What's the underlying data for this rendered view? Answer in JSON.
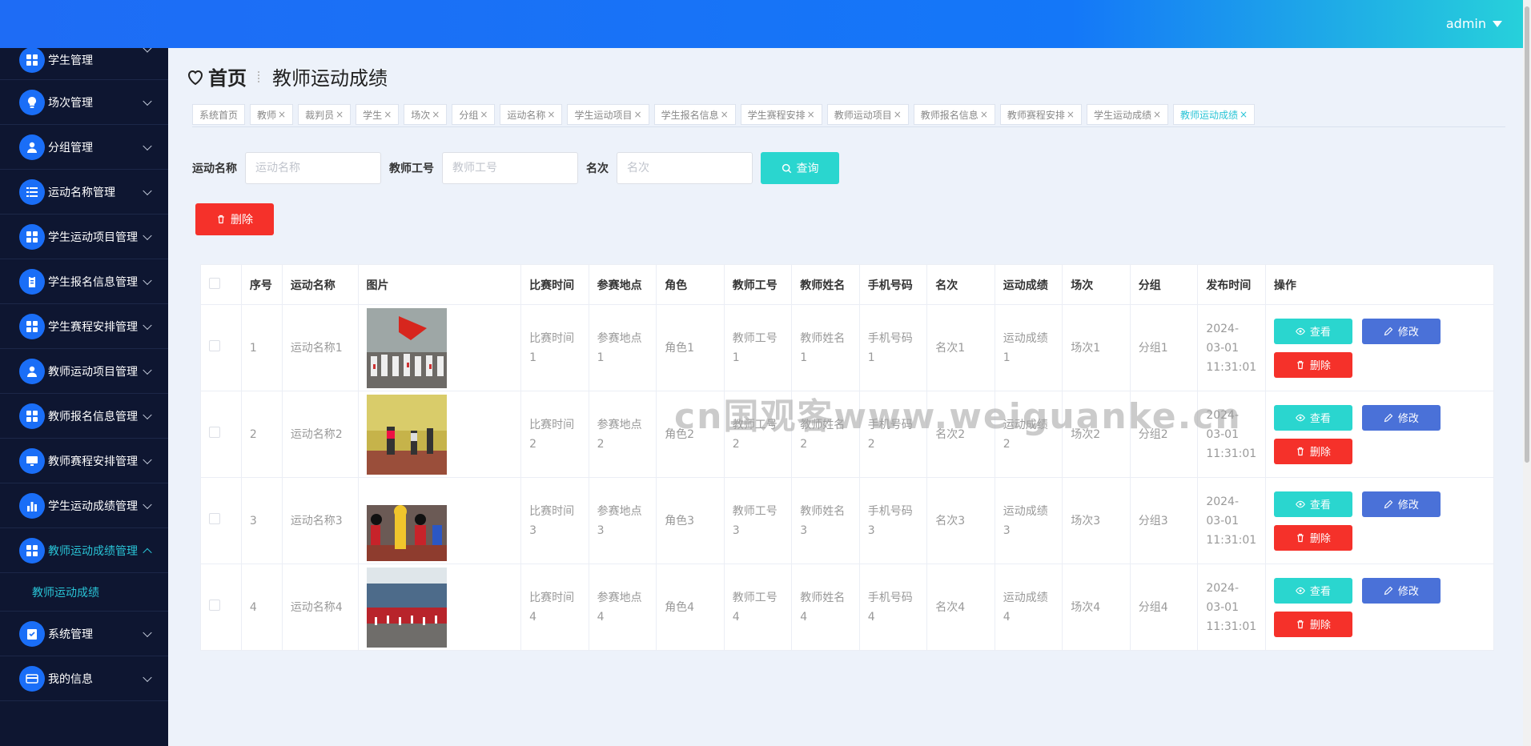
{
  "header": {
    "user": "admin"
  },
  "sidebar": {
    "items": [
      {
        "label": "学生管理",
        "icon": "grid-icon"
      },
      {
        "label": "场次管理",
        "icon": "bulb-icon"
      },
      {
        "label": "分组管理",
        "icon": "user-icon"
      },
      {
        "label": "运动名称管理",
        "icon": "list-icon"
      },
      {
        "label": "学生运动项目管理",
        "icon": "grid-icon"
      },
      {
        "label": "学生报名信息管理",
        "icon": "clipboard-icon"
      },
      {
        "label": "学生赛程安排管理",
        "icon": "grid-icon"
      },
      {
        "label": "教师运动项目管理",
        "icon": "user-icon"
      },
      {
        "label": "教师报名信息管理",
        "icon": "grid-icon"
      },
      {
        "label": "教师赛程安排管理",
        "icon": "monitor-icon"
      },
      {
        "label": "学生运动成绩管理",
        "icon": "bar-chart-icon"
      },
      {
        "label": "教师运动成绩管理",
        "icon": "grid-icon",
        "active": true
      },
      {
        "label": "系统管理",
        "icon": "checklist-icon"
      },
      {
        "label": "我的信息",
        "icon": "card-icon"
      }
    ],
    "submenu": "教师运动成绩"
  },
  "breadcrumb": {
    "home": "首页",
    "current": "教师运动成绩"
  },
  "tabs": [
    {
      "label": "系统首页",
      "closable": false
    },
    {
      "label": "教师",
      "closable": true
    },
    {
      "label": "裁判员",
      "closable": true
    },
    {
      "label": "学生",
      "closable": true
    },
    {
      "label": "场次",
      "closable": true
    },
    {
      "label": "分组",
      "closable": true
    },
    {
      "label": "运动名称",
      "closable": true
    },
    {
      "label": "学生运动项目",
      "closable": true
    },
    {
      "label": "学生报名信息",
      "closable": true
    },
    {
      "label": "学生赛程安排",
      "closable": true
    },
    {
      "label": "教师运动项目",
      "closable": true
    },
    {
      "label": "教师报名信息",
      "closable": true
    },
    {
      "label": "教师赛程安排",
      "closable": true
    },
    {
      "label": "学生运动成绩",
      "closable": true
    },
    {
      "label": "教师运动成绩",
      "closable": true,
      "active": true
    }
  ],
  "search": {
    "f1_label": "运动名称",
    "f1_placeholder": "运动名称",
    "f2_label": "教师工号",
    "f2_placeholder": "教师工号",
    "f3_label": "名次",
    "f3_placeholder": "名次",
    "query_button": "查询"
  },
  "delete_button": "删除",
  "table": {
    "columns": [
      "序号",
      "运动名称",
      "图片",
      "比赛时间",
      "参赛地点",
      "角色",
      "教师工号",
      "教师姓名",
      "手机号码",
      "名次",
      "运动成绩",
      "场次",
      "分组",
      "发布时间",
      "操作"
    ],
    "rows": [
      {
        "index": "1",
        "name": "运动名称1",
        "time": "比赛时间1",
        "place": "参赛地点1",
        "role": "角色1",
        "teacher_no": "教师工号1",
        "teacher_name": "教师姓名1",
        "phone": "手机号码1",
        "rank": "名次1",
        "score": "运动成绩1",
        "session": "场次1",
        "group": "分组1",
        "published": "2024-03-01 11:31:01",
        "photo": "flag-parade"
      },
      {
        "index": "2",
        "name": "运动名称2",
        "time": "比赛时间2",
        "place": "参赛地点2",
        "role": "角色2",
        "teacher_no": "教师工号2",
        "teacher_name": "教师姓名2",
        "phone": "手机号码2",
        "rank": "名次2",
        "score": "运动成绩2",
        "session": "场次2",
        "group": "分组2",
        "published": "2024-03-01 11:31:01",
        "photo": "runners"
      },
      {
        "index": "3",
        "name": "运动名称3",
        "time": "比赛时间3",
        "place": "参赛地点3",
        "role": "角色3",
        "teacher_no": "教师工号3",
        "teacher_name": "教师姓名3",
        "phone": "手机号码3",
        "rank": "名次3",
        "score": "运动成绩3",
        "session": "场次3",
        "group": "分组3",
        "published": "2024-03-01 11:31:01",
        "photo": "mascots"
      },
      {
        "index": "4",
        "name": "运动名称4",
        "time": "比赛时间4",
        "place": "参赛地点4",
        "role": "角色4",
        "teacher_no": "教师工号4",
        "teacher_name": "教师姓名4",
        "phone": "手机号码4",
        "rank": "名次4",
        "score": "运动成绩4",
        "session": "场次4",
        "group": "分组4",
        "published": "2024-03-01 11:31:01",
        "photo": "stadium"
      }
    ],
    "actions": {
      "view": "查看",
      "edit": "修改",
      "delete": "删除"
    }
  },
  "watermark": "cn国观客www.weiguanke.cn",
  "colors": {
    "primary": "#1a6ef7",
    "accent": "#2ad6cf",
    "danger": "#f5312a",
    "edit": "#4a71d8",
    "sidebar": "#0e1631"
  }
}
